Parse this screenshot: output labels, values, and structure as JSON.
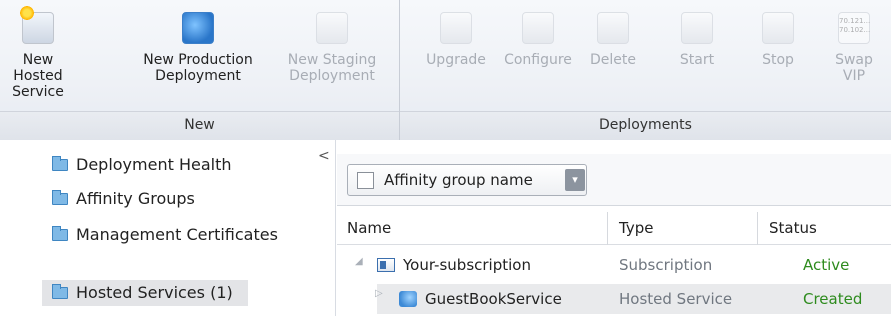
{
  "ribbon": {
    "new_group": {
      "label": "New",
      "buttons": [
        {
          "line1": "New Hosted",
          "line2": "Service",
          "icon": "new-hosted-service-icon",
          "enabled": true
        },
        {
          "line1": "New Production",
          "line2": "Deployment",
          "icon": "new-production-deployment-icon",
          "enabled": true
        },
        {
          "line1": "New Staging",
          "line2": "Deployment",
          "icon": "new-staging-deployment-icon",
          "enabled": false
        }
      ]
    },
    "deployments_group": {
      "label": "Deployments",
      "buttons": [
        {
          "line1": "Upgrade",
          "icon": "upgrade-icon",
          "enabled": false
        },
        {
          "line1": "Configure",
          "icon": "configure-icon",
          "enabled": false
        },
        {
          "line1": "Delete",
          "icon": "delete-icon",
          "enabled": false
        },
        {
          "line1": "Start",
          "icon": "start-icon",
          "enabled": false
        },
        {
          "line1": "Stop",
          "icon": "stop-icon",
          "enabled": false
        },
        {
          "line1": "Swap",
          "line2": "VIP",
          "icon": "swap-vip-icon",
          "icon_text1": "70.121...",
          "icon_text2": "70.102...",
          "enabled": false
        }
      ]
    }
  },
  "nav": {
    "collapse_glyph": "<",
    "items": [
      {
        "label": "Deployment Health",
        "icon": "folder-icon",
        "selected": false
      },
      {
        "label": "Affinity Groups",
        "icon": "folder-icon",
        "selected": false
      },
      {
        "label": "Management Certificates",
        "icon": "folder-icon",
        "selected": false
      },
      {
        "label": "Hosted Services (1)",
        "icon": "folder-icon",
        "selected": true
      }
    ]
  },
  "grid": {
    "filter_label": "Affinity group name",
    "filter_drop_glyph": "▾",
    "columns": [
      "Name",
      "Type",
      "Status"
    ],
    "rows": [
      {
        "expander": "◢",
        "name": "Your-subscription",
        "type": "Subscription",
        "status": "Active",
        "icon": "subscription-icon"
      },
      {
        "expander": "▷",
        "name": "GuestBookService",
        "type": "Hosted Service",
        "status": "Created",
        "icon": "hosted-service-icon"
      }
    ]
  },
  "colors": {
    "status_green": "#2e8b1e",
    "selection": "#e3e4e7"
  }
}
